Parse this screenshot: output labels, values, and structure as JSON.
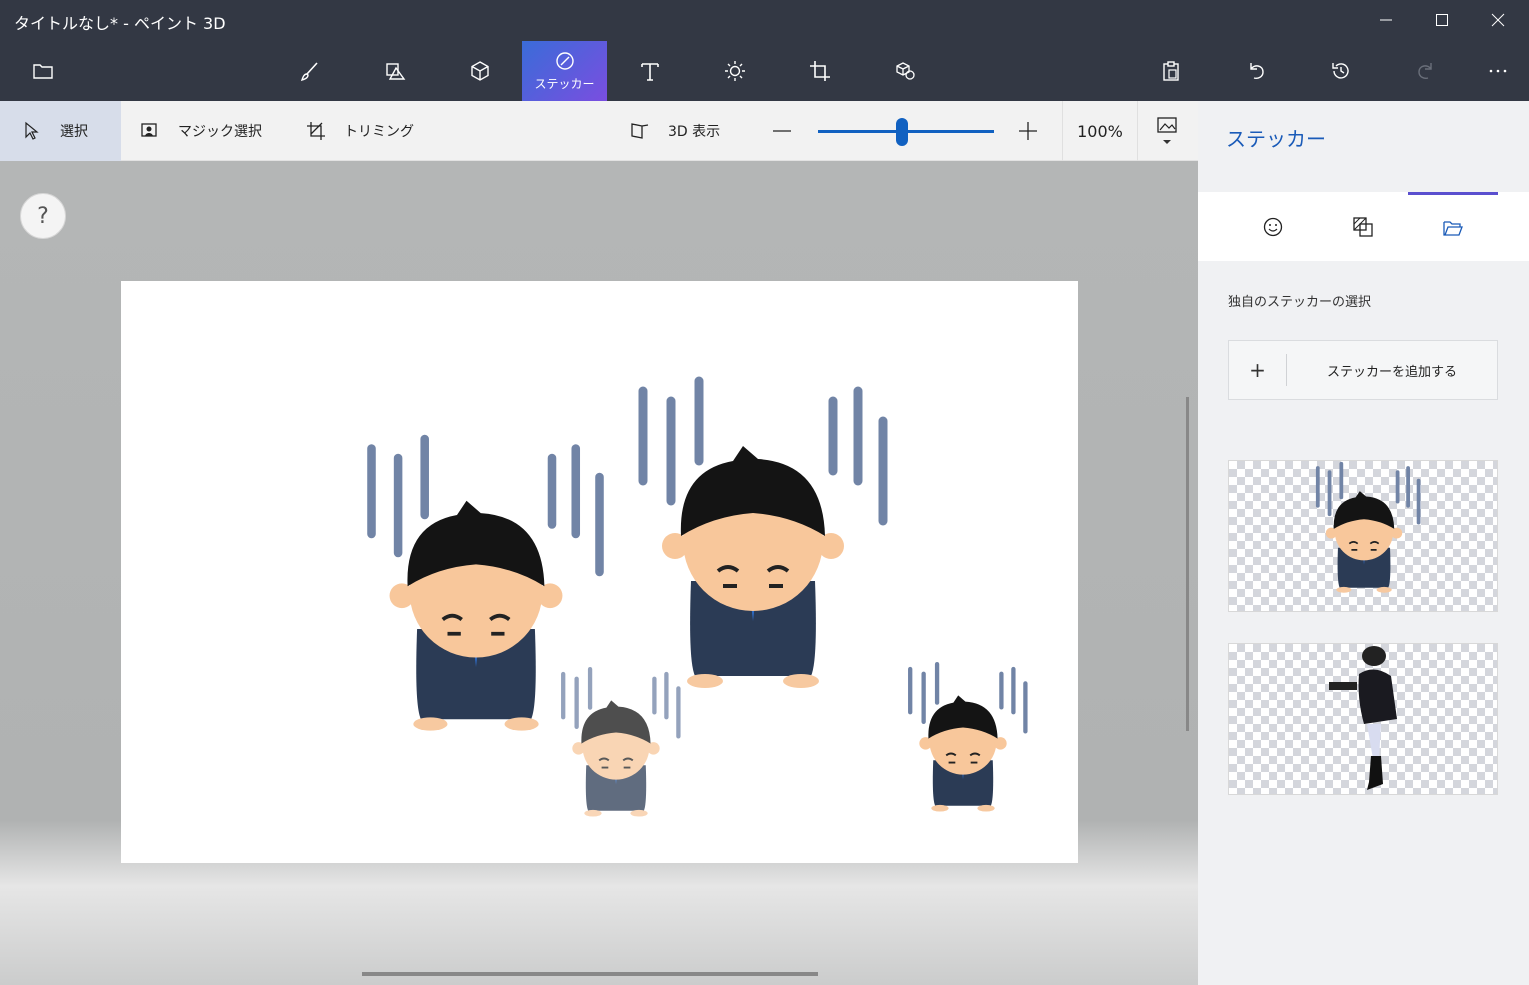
{
  "window": {
    "title": "タイトルなし* - ペイント 3D",
    "controls": [
      "minimize-icon",
      "maximize-icon",
      "close-icon"
    ]
  },
  "toolbar": {
    "menu_icon": "folder-icon",
    "tools": [
      {
        "name": "brushes",
        "icon": "brush-icon",
        "label": ""
      },
      {
        "name": "2d-shapes",
        "icon": "2d-shapes-icon",
        "label": ""
      },
      {
        "name": "3d-shapes",
        "icon": "3d-cube-icon",
        "label": ""
      },
      {
        "name": "stickers",
        "icon": "sticker-icon",
        "label": "ステッカー",
        "active": true
      },
      {
        "name": "text",
        "icon": "text-icon",
        "label": ""
      },
      {
        "name": "effects",
        "icon": "effects-icon",
        "label": ""
      },
      {
        "name": "canvas",
        "icon": "canvas-icon",
        "label": ""
      },
      {
        "name": "3d-library",
        "icon": "3d-library-icon",
        "label": ""
      }
    ],
    "right_icons": [
      "paste-icon",
      "undo-icon",
      "history-icon",
      "redo-icon",
      "more-icon"
    ]
  },
  "subbar": {
    "select_label": "選択",
    "magic_select_label": "マジック選択",
    "crop_label": "トリミング",
    "view3d_label": "3D 表示",
    "zoom_value": "100%",
    "zoom_fraction": 0.48
  },
  "canvas": {
    "help_label": "?"
  },
  "panel": {
    "title": "ステッカー",
    "tabs": [
      "sticker-face-icon",
      "textures-icon",
      "custom-folder-icon"
    ],
    "active_tab": 2,
    "subtitle": "独自のステッカーの選択",
    "add_plus": "+",
    "add_label": "ステッカーを追加する"
  },
  "colors": {
    "titlebar": "#333844",
    "accent": "#1161c1",
    "active_tool_gradient": [
      "#3a6cd8",
      "#7a4ee0"
    ]
  }
}
